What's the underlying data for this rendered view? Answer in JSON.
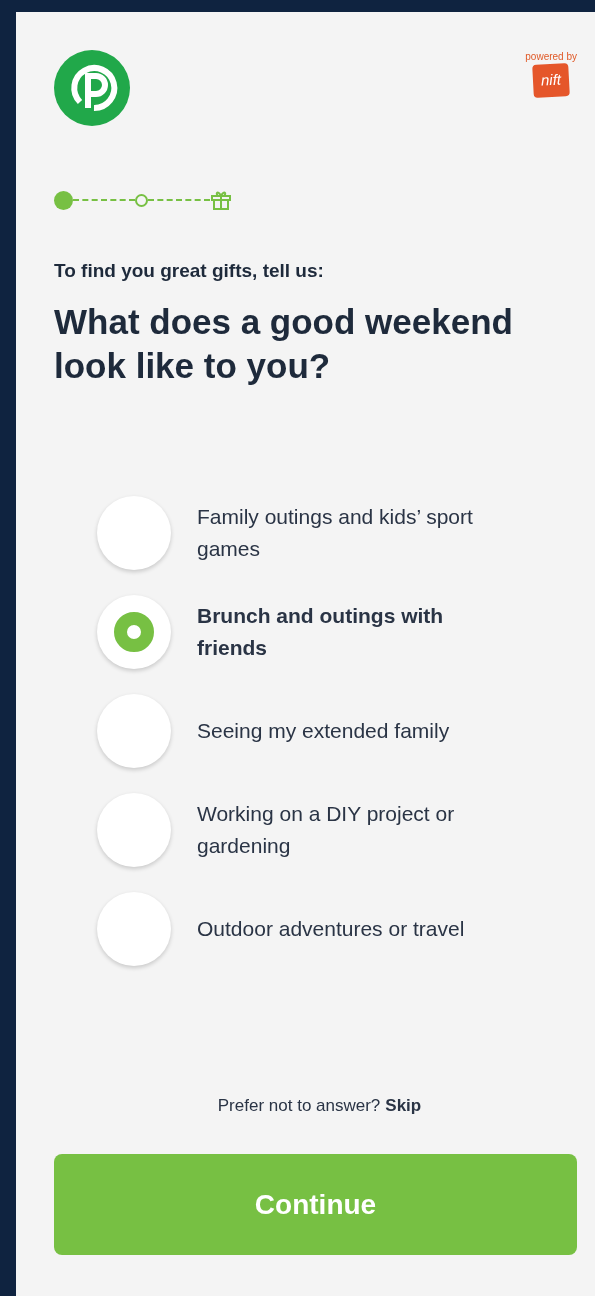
{
  "header": {
    "badge": {
      "caption": "powered by",
      "brand": "nift"
    }
  },
  "progress": {
    "steps": [
      {
        "kind": "dot",
        "done": true
      },
      {
        "kind": "dot",
        "done": false
      },
      {
        "kind": "gift",
        "done": false
      }
    ]
  },
  "question": {
    "intro": "To find you great gifts, tell us:",
    "title": "What does a good weekend look like to you?"
  },
  "options": [
    {
      "label": "Family outings and kids’ sport games",
      "selected": false
    },
    {
      "label": "Brunch and outings with friends",
      "selected": true
    },
    {
      "label": "Seeing my extended family",
      "selected": false
    },
    {
      "label": "Working on a DIY project or gardening",
      "selected": false
    },
    {
      "label": "Outdoor adventures or travel",
      "selected": false
    }
  ],
  "skip": {
    "prompt": "Prefer not to answer?",
    "link": "Skip"
  },
  "continue_button": "Continue"
}
